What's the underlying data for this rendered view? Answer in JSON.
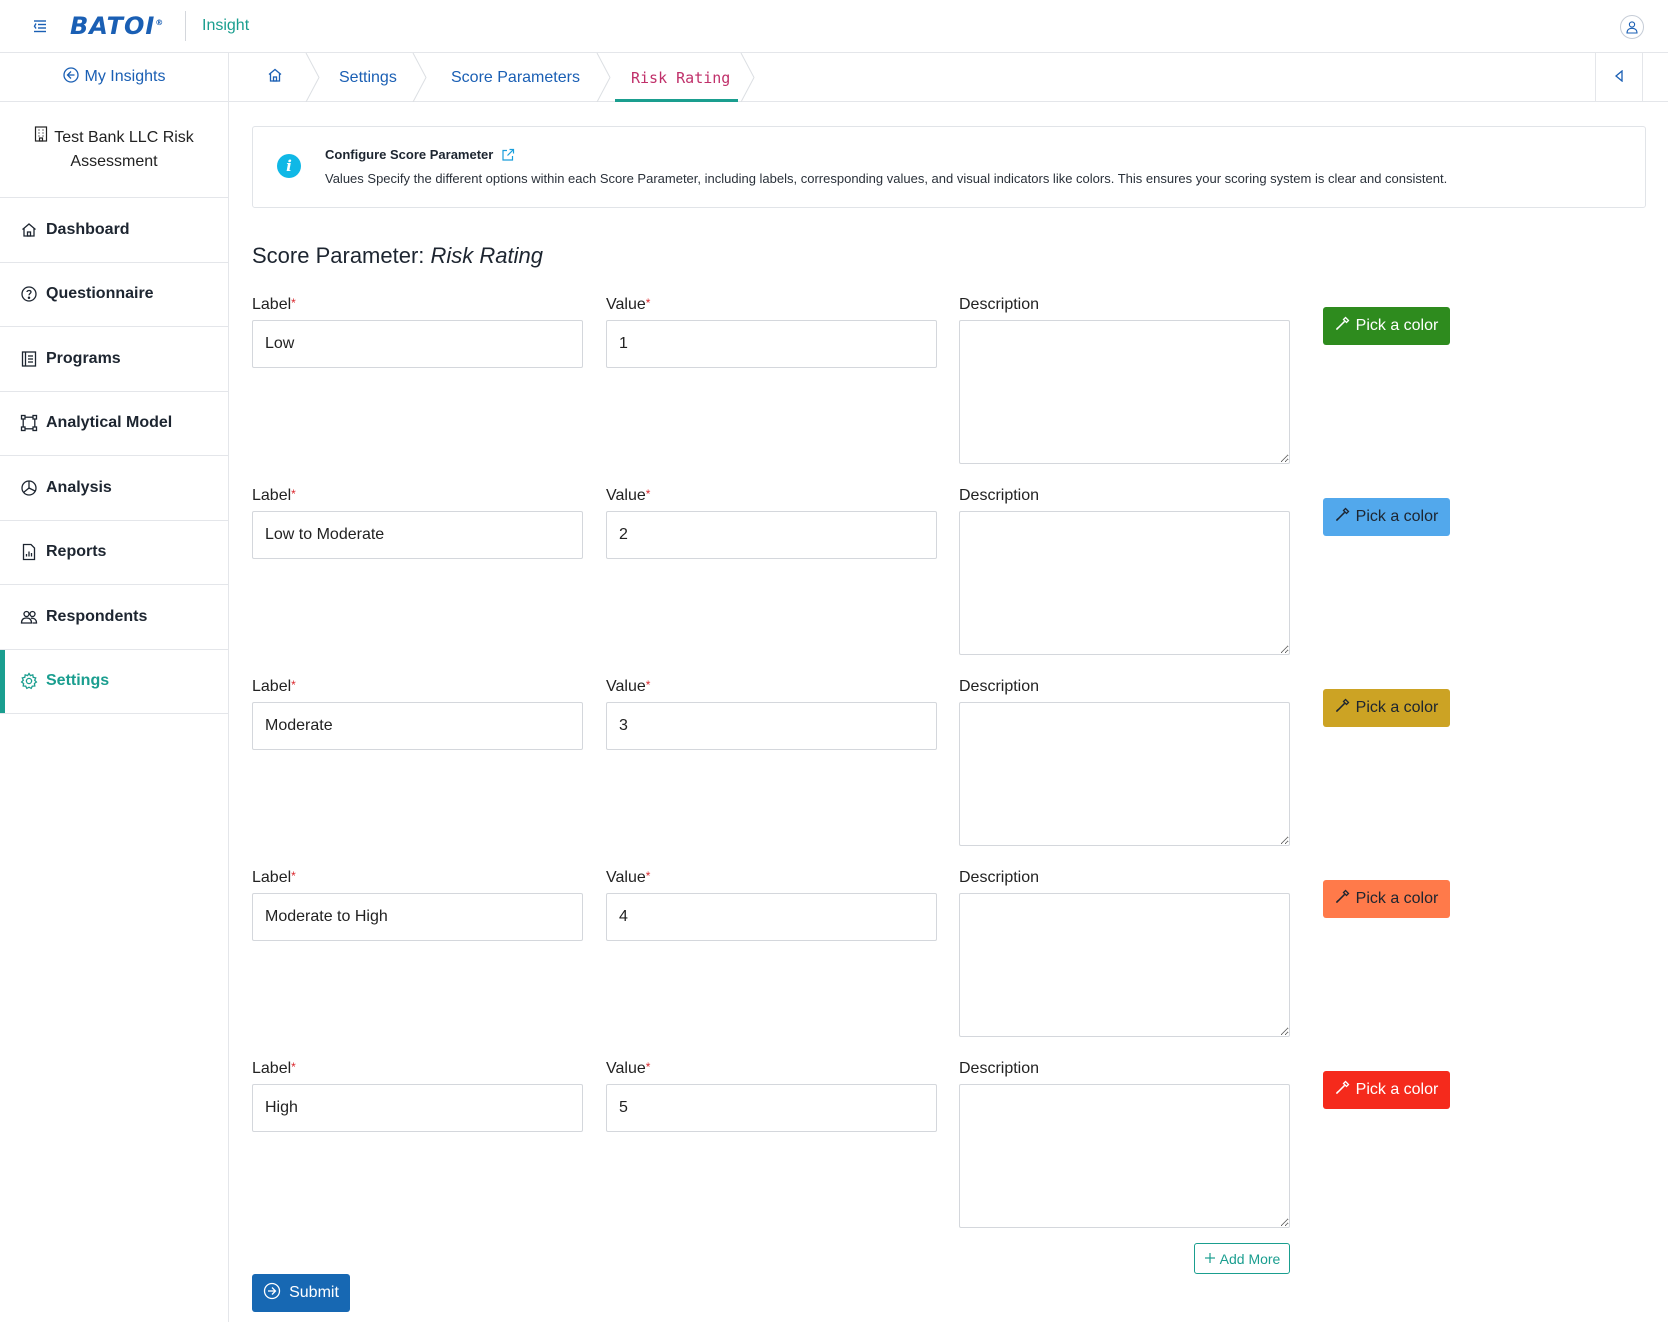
{
  "header": {
    "logo_text": "BATOI",
    "logo_reg": "®",
    "app_name": "Insight"
  },
  "sidebar": {
    "back_label": "My Insights",
    "project_line1": "Test Bank LLC Risk",
    "project_line2": "Assessment",
    "items": [
      {
        "label": "Dashboard",
        "icon": "home-icon"
      },
      {
        "label": "Questionnaire",
        "icon": "question-circle-icon"
      },
      {
        "label": "Programs",
        "icon": "list-icon"
      },
      {
        "label": "Analytical Model",
        "icon": "model-icon"
      },
      {
        "label": "Analysis",
        "icon": "pie-chart-icon"
      },
      {
        "label": "Reports",
        "icon": "report-icon"
      },
      {
        "label": "Respondents",
        "icon": "users-icon"
      },
      {
        "label": "Settings",
        "icon": "gear-icon",
        "active": true
      }
    ]
  },
  "breadcrumb": {
    "items": [
      "Settings",
      "Score Parameters",
      "Risk Rating"
    ]
  },
  "info": {
    "title": "Configure Score Parameter",
    "description": "Values Specify the different options within each Score Parameter, including labels, corresponding values, and visual indicators like colors. This ensures your scoring system is clear and consistent."
  },
  "heading": {
    "prefix": "Score Parameter:",
    "name": "Risk Rating"
  },
  "form": {
    "label_caption": "Label",
    "value_caption": "Value",
    "description_caption": "Description",
    "required_mark": "*",
    "color_button_label": "Pick a color",
    "rows": [
      {
        "label": "Low",
        "value": "1",
        "description": "",
        "color": "#2e8b1e",
        "text_color": "#ffffff"
      },
      {
        "label": "Low to Moderate",
        "value": "2",
        "description": "",
        "color": "#52a8ec",
        "text_color": "#1d2530"
      },
      {
        "label": "Moderate",
        "value": "3",
        "description": "",
        "color": "#cca324",
        "text_color": "#1d2530"
      },
      {
        "label": "Moderate to High",
        "value": "4",
        "description": "",
        "color": "#ff7a4a",
        "text_color": "#1d2530"
      },
      {
        "label": "High",
        "value": "5",
        "description": "",
        "color": "#f52a1c",
        "text_color": "#ffffff"
      }
    ],
    "add_more_label": "Add More",
    "submit_label": "Submit"
  }
}
